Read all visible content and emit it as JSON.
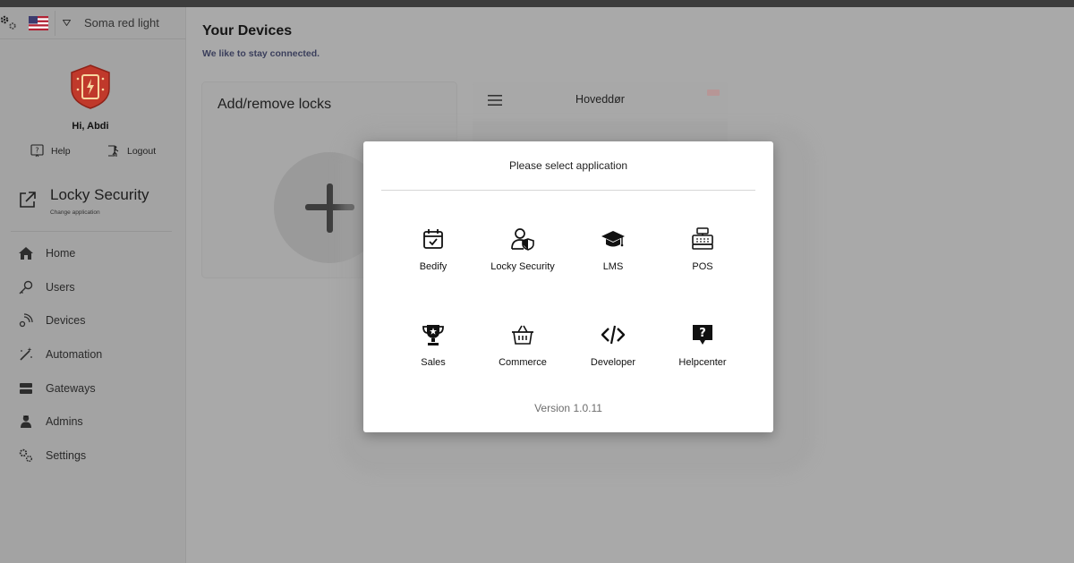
{
  "header": {
    "store_name": "Soma red light",
    "flag_icon": "us-flag-icon",
    "settings_icon": "gear-icon"
  },
  "sidebar": {
    "logo_icon": "locky-shield-logo",
    "greeting": "Hi, Abdi",
    "help_label": "Help",
    "logout_label": "Logout",
    "app_name": "Locky Security",
    "app_subtitle": "Change application",
    "nav": [
      {
        "label": "Home",
        "icon": "home-icon"
      },
      {
        "label": "Users",
        "icon": "key-icon"
      },
      {
        "label": "Devices",
        "icon": "signal-icon"
      },
      {
        "label": "Automation",
        "icon": "magic-wand-icon"
      },
      {
        "label": "Gateways",
        "icon": "server-icon"
      },
      {
        "label": "Admins",
        "icon": "admin-icon"
      },
      {
        "label": "Settings",
        "icon": "gears-icon"
      }
    ]
  },
  "main": {
    "title": "Your Devices",
    "subtitle": "We like to stay connected.",
    "add_card_title": "Add/remove locks",
    "device_card_title": "Hoveddør"
  },
  "modal": {
    "title": "Please select application",
    "apps": [
      {
        "label": "Bedify",
        "icon": "calendar-check-icon"
      },
      {
        "label": "Locky Security",
        "icon": "user-shield-icon"
      },
      {
        "label": "LMS",
        "icon": "graduation-cap-icon"
      },
      {
        "label": "POS",
        "icon": "cash-register-icon"
      },
      {
        "label": "Sales",
        "icon": "trophy-icon"
      },
      {
        "label": "Commerce",
        "icon": "shopping-basket-icon"
      },
      {
        "label": "Developer",
        "icon": "code-icon"
      },
      {
        "label": "Helpcenter",
        "icon": "question-bubble-icon"
      }
    ],
    "version": "Version 1.0.11"
  },
  "colors": {
    "overlay_gray": "#a9a9a9",
    "brand_red": "#c0392b",
    "modal_bg": "#ffffff"
  }
}
